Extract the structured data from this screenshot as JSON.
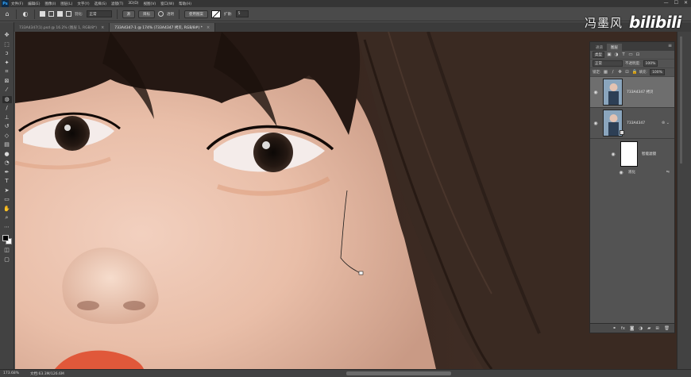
{
  "app": {
    "logo": "Ps"
  },
  "menu": [
    "文件(F)",
    "编辑(E)",
    "图像(I)",
    "图层(L)",
    "文字(Y)",
    "选择(S)",
    "滤镜(T)",
    "3D(D)",
    "视图(V)",
    "窗口(W)",
    "帮助(H)"
  ],
  "window_controls": {
    "minimize": "—",
    "maximize": "☐",
    "close": "✕"
  },
  "options_bar": {
    "feather_label": "羽化:",
    "mode_value": "正常",
    "source_label": "源",
    "target_label": "目标",
    "transparent_label": "透明",
    "use_pattern_label": "使用图案",
    "diffusion_label": "扩散:",
    "diffusion_value": "5"
  },
  "tabs": [
    {
      "label": "733A4347(1).psd @ 16.2% (图层 1, RGB/8*)",
      "close": "×"
    },
    {
      "label": "733A4347-1 @ 174% (733A4347 拷贝, RGB/8#) *",
      "close": "×"
    }
  ],
  "watermark": {
    "author": "冯墨风",
    "logo_text": "bilibili"
  },
  "layers_panel": {
    "tabs": [
      "通道",
      "图层"
    ],
    "filter_kind": "类型",
    "blend_mode": "正常",
    "opacity_label": "不透明度:",
    "opacity_value": "100%",
    "lock_label": "锁定:",
    "fill_label": "填充:",
    "fill_value": "100%",
    "layers": [
      {
        "name": "733A4347 拷贝"
      },
      {
        "name": "733A4347"
      }
    ],
    "smart_filters_label": "智能滤镜",
    "filter_item_label": "液化"
  },
  "status": {
    "zoom": "173.68%",
    "doc_info": "文档:63.3M/126.6M"
  },
  "colors": {
    "accent": "#31a8ff",
    "foreground": "#000000",
    "background": "#ffffff"
  }
}
